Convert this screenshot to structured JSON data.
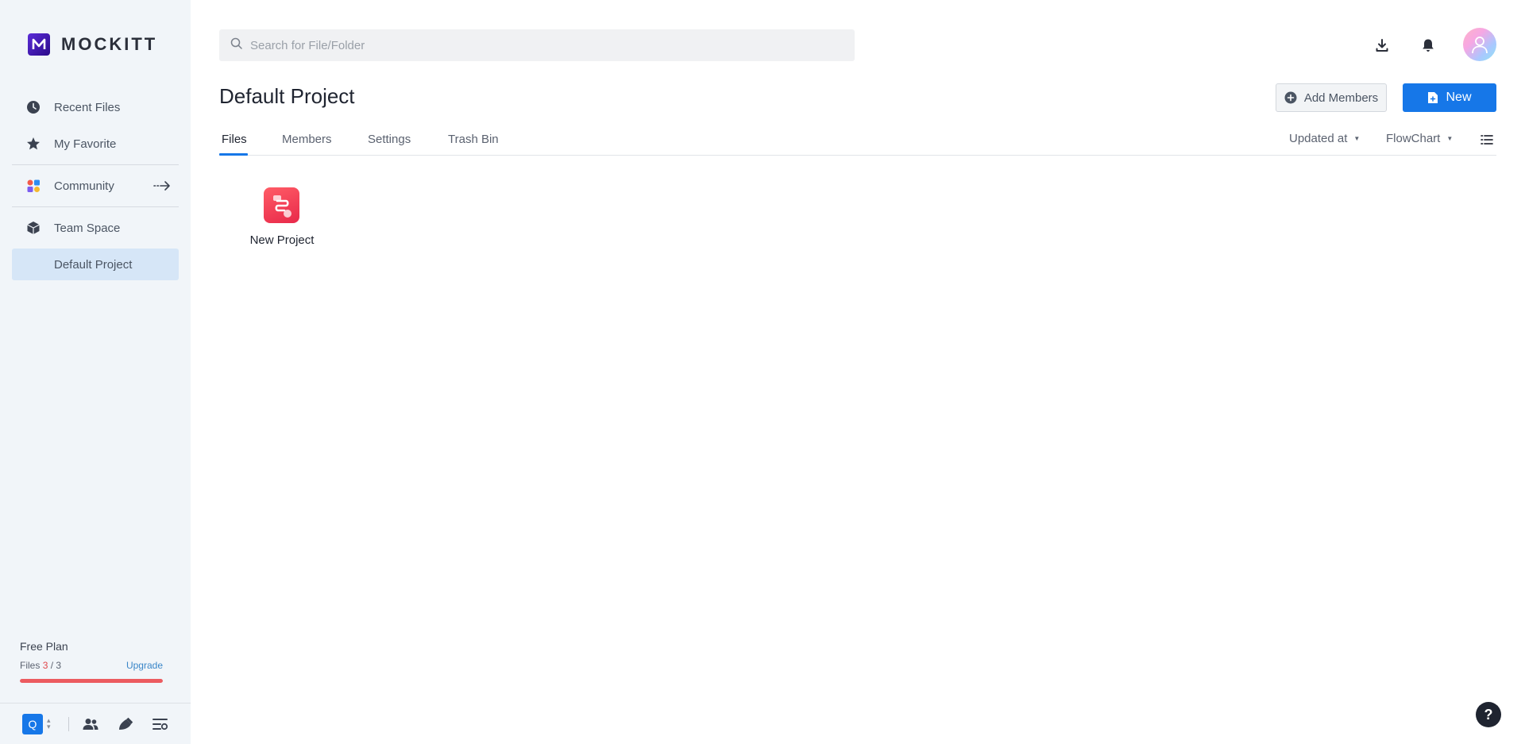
{
  "brand": {
    "name": "MOCKITT",
    "logo_letter": "M",
    "accent": "#1677e8",
    "logo_color": "#4a1fc4"
  },
  "sidebar": {
    "items": [
      {
        "label": "Recent Files",
        "icon": "clock-icon"
      },
      {
        "label": "My Favorite",
        "icon": "star-icon"
      },
      {
        "label": "Community",
        "icon": "community-icon"
      },
      {
        "label": "Team Space",
        "icon": "cube-icon"
      },
      {
        "label": "Default Project",
        "icon": "",
        "active": true
      }
    ]
  },
  "plan": {
    "title": "Free Plan",
    "files_label": "Files",
    "files_used": "3",
    "files_sep": " / ",
    "files_total": "3",
    "upgrade_label": "Upgrade",
    "usage_fraction": 1.0,
    "usage_color": "#ec5b60"
  },
  "bottom_bar": {
    "team_letter": "Q",
    "icons": [
      "team-members-icon",
      "design-icon",
      "settings-list-icon"
    ]
  },
  "search": {
    "placeholder": "Search for File/Folder",
    "value": ""
  },
  "header": {
    "icons": [
      "download-icon",
      "bell-icon",
      "avatar"
    ]
  },
  "main": {
    "title": "Default Project",
    "add_members_label": "Add Members",
    "new_label": "New",
    "tabs": [
      {
        "label": "Files",
        "active": true
      },
      {
        "label": "Members"
      },
      {
        "label": "Settings"
      },
      {
        "label": "Trash Bin"
      }
    ],
    "sort_label": "Updated at",
    "filter_label": "FlowChart",
    "files": [
      {
        "name": "New Project",
        "icon": "flowchart-file-icon",
        "color": "#ee3a52"
      }
    ]
  },
  "help_label": "?"
}
